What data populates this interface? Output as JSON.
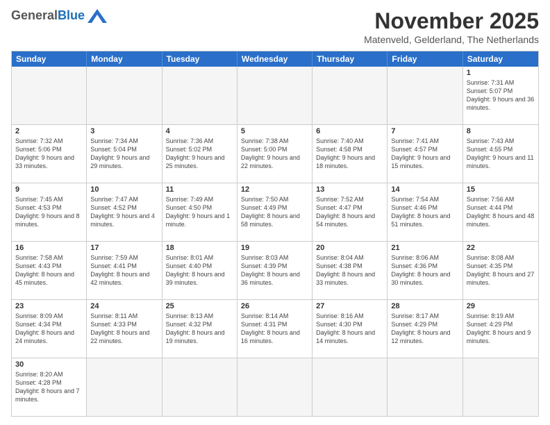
{
  "header": {
    "logo": {
      "general": "General",
      "blue": "Blue"
    },
    "title": "November 2025",
    "subtitle": "Matenveld, Gelderland, The Netherlands"
  },
  "calendar": {
    "days_of_week": [
      "Sunday",
      "Monday",
      "Tuesday",
      "Wednesday",
      "Thursday",
      "Friday",
      "Saturday"
    ],
    "rows": [
      [
        {
          "day": "",
          "info": ""
        },
        {
          "day": "",
          "info": ""
        },
        {
          "day": "",
          "info": ""
        },
        {
          "day": "",
          "info": ""
        },
        {
          "day": "",
          "info": ""
        },
        {
          "day": "",
          "info": ""
        },
        {
          "day": "1",
          "info": "Sunrise: 7:31 AM\nSunset: 5:07 PM\nDaylight: 9 hours and 36 minutes."
        }
      ],
      [
        {
          "day": "2",
          "info": "Sunrise: 7:32 AM\nSunset: 5:06 PM\nDaylight: 9 hours and 33 minutes."
        },
        {
          "day": "3",
          "info": "Sunrise: 7:34 AM\nSunset: 5:04 PM\nDaylight: 9 hours and 29 minutes."
        },
        {
          "day": "4",
          "info": "Sunrise: 7:36 AM\nSunset: 5:02 PM\nDaylight: 9 hours and 25 minutes."
        },
        {
          "day": "5",
          "info": "Sunrise: 7:38 AM\nSunset: 5:00 PM\nDaylight: 9 hours and 22 minutes."
        },
        {
          "day": "6",
          "info": "Sunrise: 7:40 AM\nSunset: 4:58 PM\nDaylight: 9 hours and 18 minutes."
        },
        {
          "day": "7",
          "info": "Sunrise: 7:41 AM\nSunset: 4:57 PM\nDaylight: 9 hours and 15 minutes."
        },
        {
          "day": "8",
          "info": "Sunrise: 7:43 AM\nSunset: 4:55 PM\nDaylight: 9 hours and 11 minutes."
        }
      ],
      [
        {
          "day": "9",
          "info": "Sunrise: 7:45 AM\nSunset: 4:53 PM\nDaylight: 9 hours and 8 minutes."
        },
        {
          "day": "10",
          "info": "Sunrise: 7:47 AM\nSunset: 4:52 PM\nDaylight: 9 hours and 4 minutes."
        },
        {
          "day": "11",
          "info": "Sunrise: 7:49 AM\nSunset: 4:50 PM\nDaylight: 9 hours and 1 minute."
        },
        {
          "day": "12",
          "info": "Sunrise: 7:50 AM\nSunset: 4:49 PM\nDaylight: 8 hours and 58 minutes."
        },
        {
          "day": "13",
          "info": "Sunrise: 7:52 AM\nSunset: 4:47 PM\nDaylight: 8 hours and 54 minutes."
        },
        {
          "day": "14",
          "info": "Sunrise: 7:54 AM\nSunset: 4:46 PM\nDaylight: 8 hours and 51 minutes."
        },
        {
          "day": "15",
          "info": "Sunrise: 7:56 AM\nSunset: 4:44 PM\nDaylight: 8 hours and 48 minutes."
        }
      ],
      [
        {
          "day": "16",
          "info": "Sunrise: 7:58 AM\nSunset: 4:43 PM\nDaylight: 8 hours and 45 minutes."
        },
        {
          "day": "17",
          "info": "Sunrise: 7:59 AM\nSunset: 4:41 PM\nDaylight: 8 hours and 42 minutes."
        },
        {
          "day": "18",
          "info": "Sunrise: 8:01 AM\nSunset: 4:40 PM\nDaylight: 8 hours and 39 minutes."
        },
        {
          "day": "19",
          "info": "Sunrise: 8:03 AM\nSunset: 4:39 PM\nDaylight: 8 hours and 36 minutes."
        },
        {
          "day": "20",
          "info": "Sunrise: 8:04 AM\nSunset: 4:38 PM\nDaylight: 8 hours and 33 minutes."
        },
        {
          "day": "21",
          "info": "Sunrise: 8:06 AM\nSunset: 4:36 PM\nDaylight: 8 hours and 30 minutes."
        },
        {
          "day": "22",
          "info": "Sunrise: 8:08 AM\nSunset: 4:35 PM\nDaylight: 8 hours and 27 minutes."
        }
      ],
      [
        {
          "day": "23",
          "info": "Sunrise: 8:09 AM\nSunset: 4:34 PM\nDaylight: 8 hours and 24 minutes."
        },
        {
          "day": "24",
          "info": "Sunrise: 8:11 AM\nSunset: 4:33 PM\nDaylight: 8 hours and 22 minutes."
        },
        {
          "day": "25",
          "info": "Sunrise: 8:13 AM\nSunset: 4:32 PM\nDaylight: 8 hours and 19 minutes."
        },
        {
          "day": "26",
          "info": "Sunrise: 8:14 AM\nSunset: 4:31 PM\nDaylight: 8 hours and 16 minutes."
        },
        {
          "day": "27",
          "info": "Sunrise: 8:16 AM\nSunset: 4:30 PM\nDaylight: 8 hours and 14 minutes."
        },
        {
          "day": "28",
          "info": "Sunrise: 8:17 AM\nSunset: 4:29 PM\nDaylight: 8 hours and 12 minutes."
        },
        {
          "day": "29",
          "info": "Sunrise: 8:19 AM\nSunset: 4:29 PM\nDaylight: 8 hours and 9 minutes."
        }
      ],
      [
        {
          "day": "30",
          "info": "Sunrise: 8:20 AM\nSunset: 4:28 PM\nDaylight: 8 hours and 7 minutes."
        },
        {
          "day": "",
          "info": ""
        },
        {
          "day": "",
          "info": ""
        },
        {
          "day": "",
          "info": ""
        },
        {
          "day": "",
          "info": ""
        },
        {
          "day": "",
          "info": ""
        },
        {
          "day": "",
          "info": ""
        }
      ]
    ]
  }
}
